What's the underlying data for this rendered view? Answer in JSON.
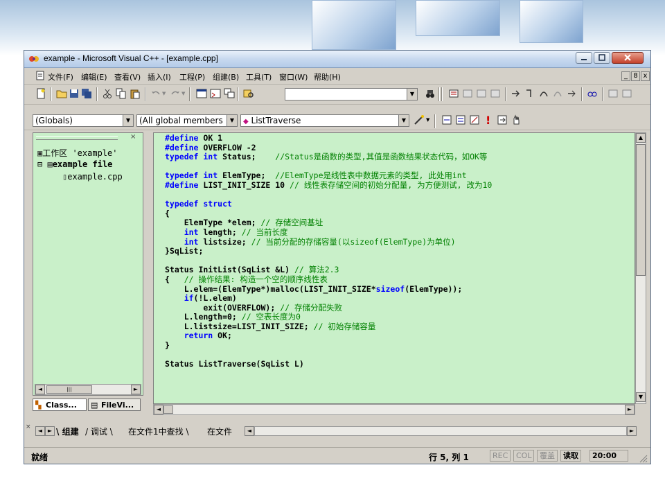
{
  "window": {
    "title": "example - Microsoft Visual C++ - [example.cpp]"
  },
  "menu": {
    "items": [
      "文件(F)",
      "编辑(E)",
      "查看(V)",
      "插入(I)",
      "工程(P)",
      "组建(B)",
      "工具(T)",
      "窗口(W)",
      "帮助(H)"
    ],
    "mdi_buttons": [
      "_",
      "8",
      "x"
    ]
  },
  "wizard_bar": {
    "class_combo": "(Globals)",
    "filter_combo": "(All global members",
    "member_combo": "ListTraverse"
  },
  "workspace": {
    "root": "工作区 'example'",
    "project": "example file",
    "file": "example.cpp",
    "tabs": [
      "Class...",
      "FileVi..."
    ]
  },
  "editor": {
    "lines": [
      [
        [
          "kw",
          "#define "
        ],
        [
          "tx",
          "OK 1"
        ]
      ],
      [
        [
          "kw",
          "#define "
        ],
        [
          "tx",
          "OVERFLOW -2"
        ]
      ],
      [
        [
          "kw",
          "typedef int "
        ],
        [
          "tx",
          "Status;    "
        ],
        [
          "cm",
          "//Status是函数的类型,其值是函数结果状态代码，如OK等"
        ]
      ],
      [
        [
          "tx",
          ""
        ]
      ],
      [
        [
          "kw",
          "typedef int "
        ],
        [
          "tx",
          "ElemType;  "
        ],
        [
          "cm",
          "//ElemType是线性表中数据元素的类型, 此处用int"
        ]
      ],
      [
        [
          "kw",
          "#define "
        ],
        [
          "tx",
          "LIST_INIT_SIZE 10 "
        ],
        [
          "cm",
          "// 线性表存储空间的初始分配量, 为方便测试, 改为10"
        ]
      ],
      [
        [
          "tx",
          ""
        ]
      ],
      [
        [
          "kw",
          "typedef struct"
        ]
      ],
      [
        [
          "tx",
          "{"
        ]
      ],
      [
        [
          "tx",
          "    ElemType *elem; "
        ],
        [
          "cm",
          "// 存储空间基址"
        ]
      ],
      [
        [
          "kw",
          "    int "
        ],
        [
          "tx",
          "length; "
        ],
        [
          "cm",
          "// 当前长度"
        ]
      ],
      [
        [
          "kw",
          "    int "
        ],
        [
          "tx",
          "listsize; "
        ],
        [
          "cm",
          "// 当前分配的存储容量(以sizeof(ElemType)为单位)"
        ]
      ],
      [
        [
          "tx",
          "}SqList;"
        ]
      ],
      [
        [
          "tx",
          ""
        ]
      ],
      [
        [
          "tx",
          "Status InitList(SqList &L) "
        ],
        [
          "cm",
          "// 算法2.3"
        ]
      ],
      [
        [
          "tx",
          "{   "
        ],
        [
          "cm",
          "// 操作结果: 构造一个空的顺序线性表"
        ]
      ],
      [
        [
          "tx",
          "    L.elem=(ElemType*)malloc(LIST_INIT_SIZE*"
        ],
        [
          "kw",
          "sizeof"
        ],
        [
          "tx",
          "(ElemType));"
        ]
      ],
      [
        [
          "kw",
          "    if"
        ],
        [
          "tx",
          "(!L.elem)"
        ]
      ],
      [
        [
          "tx",
          "        exit(OVERFLOW); "
        ],
        [
          "cm",
          "// 存储分配失败"
        ]
      ],
      [
        [
          "tx",
          "    L.length=0; "
        ],
        [
          "cm",
          "// 空表长度为0"
        ]
      ],
      [
        [
          "tx",
          "    L.listsize=LIST_INIT_SIZE; "
        ],
        [
          "cm",
          "// 初始存储容量"
        ]
      ],
      [
        [
          "kw",
          "    return "
        ],
        [
          "tx",
          "OK;"
        ]
      ],
      [
        [
          "tx",
          "}"
        ]
      ],
      [
        [
          "tx",
          ""
        ]
      ],
      [
        [
          "tx",
          "Status ListTraverse(SqList L)"
        ]
      ]
    ]
  },
  "output_tabs": [
    "组建",
    "调试",
    "在文件1中查找",
    "在文件"
  ],
  "status": {
    "ready": "就绪",
    "position": "行 5, 列 1",
    "rec": "REC",
    "col": "COL",
    "ovr": "覆盖",
    "read": "读取",
    "time": "20:00"
  },
  "colors": {
    "editor_bg": "#c9f0c9",
    "keyword": "#0000ff",
    "comment": "#008000",
    "chrome": "#d4d0c8"
  }
}
